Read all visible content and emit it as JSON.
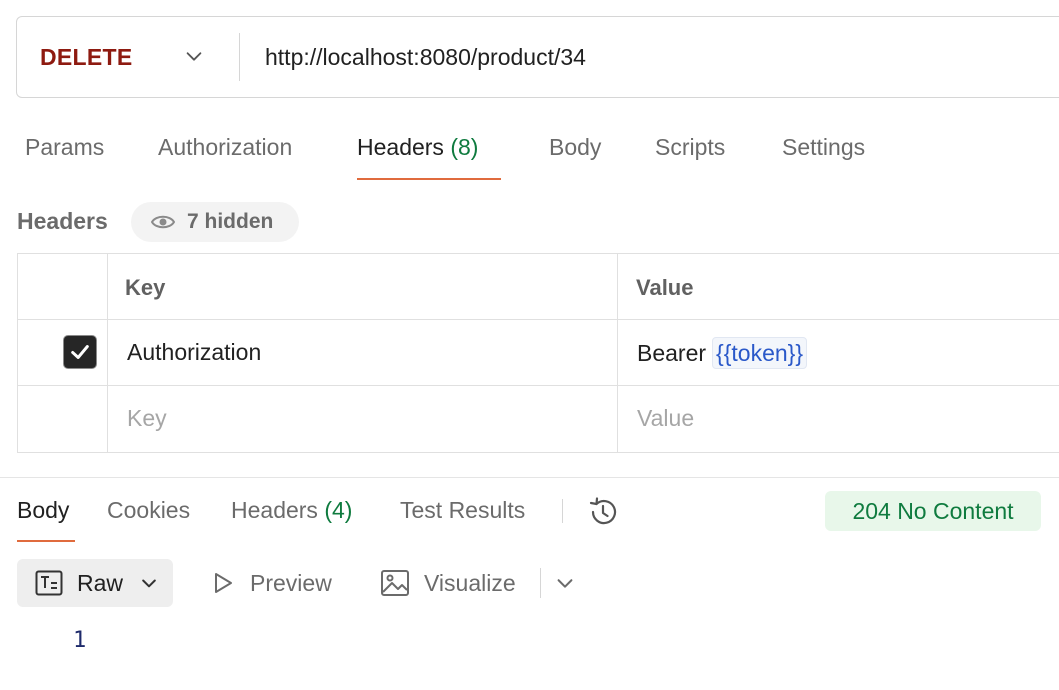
{
  "request": {
    "method": "DELETE",
    "url": "http://localhost:8080/product/34"
  },
  "request_tabs": {
    "params": "Params",
    "authorization": "Authorization",
    "headers_label": "Headers",
    "headers_count": "(8)",
    "body": "Body",
    "scripts": "Scripts",
    "settings": "Settings",
    "active": "Headers"
  },
  "headers_section": {
    "title": "Headers",
    "hidden_label": "7 hidden",
    "columns": {
      "key": "Key",
      "value": "Value"
    },
    "rows": [
      {
        "checked": true,
        "key": "Authorization",
        "value_prefix": "Bearer",
        "value_token": "{{token}}"
      }
    ],
    "placeholders": {
      "key": "Key",
      "value": "Value"
    }
  },
  "response_tabs": {
    "body": "Body",
    "cookies": "Cookies",
    "headers_label": "Headers",
    "headers_count": "(4)",
    "test_results": "Test Results",
    "active": "Body"
  },
  "status": {
    "text": "204 No Content",
    "color": "#0f7b3f",
    "background": "#e8f7ea"
  },
  "body_toolbar": {
    "format": "Raw",
    "preview": "Preview",
    "visualize": "Visualize"
  },
  "body_content": {
    "line_numbers": [
      "1"
    ]
  },
  "colors": {
    "method": "#8e1a10",
    "accent_underline": "#e06b3d",
    "token": "#2a58c9"
  },
  "icons": [
    "chevron-down-icon",
    "eye-icon",
    "checkmark-icon",
    "history-icon",
    "raw-text-icon",
    "play-icon",
    "image-icon"
  ]
}
